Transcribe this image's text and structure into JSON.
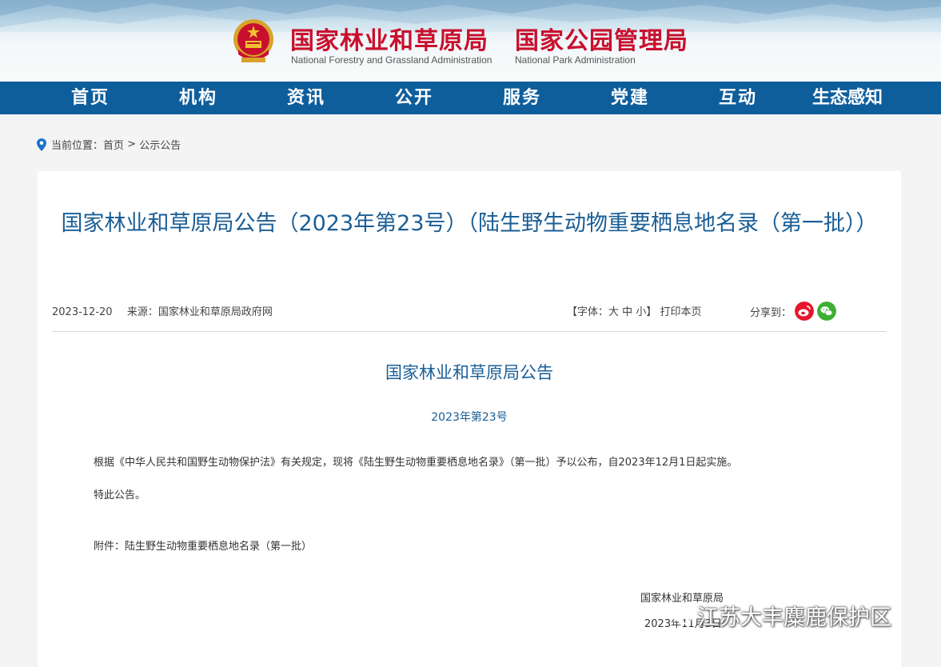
{
  "header": {
    "org1_cn": "国家林业和草原局",
    "org1_en": "National Forestry and Grassland Administration",
    "org2_cn": "国家公园管理局",
    "org2_en": "National Park Administration"
  },
  "nav": {
    "items": [
      "首页",
      "机构",
      "资讯",
      "公开",
      "服务",
      "党建",
      "互动",
      "生态感知"
    ]
  },
  "breadcrumb": {
    "label": "当前位置：",
    "home": "首页",
    "sep": " > ",
    "current": "公示公告"
  },
  "article": {
    "title": "国家林业和草原局公告（2023年第23号）（陆生野生动物重要栖息地名录（第一批））",
    "date": "2023-12-20",
    "source_label": "来源：",
    "source": "国家林业和草原局政府网",
    "font_prefix": "【字体：",
    "font_large": "大",
    "font_medium": "中",
    "font_small": "小",
    "font_suffix": "】",
    "print": "打印本页",
    "share_label": "分享到：",
    "doc_heading": "国家林业和草原局公告",
    "doc_number": "2023年第23号",
    "paragraph1": "根据《中华人民共和国野生动物保护法》有关规定，现将《陆生野生动物重要栖息地名录》（第一批）予以公布，自2023年12月1日起实施。",
    "paragraph2": "特此公告。",
    "attachment": "附件：陆生野生动物重要栖息地名录（第一批）",
    "signature": "国家林业和草原局",
    "signature_date": "2023年11月3日"
  },
  "watermark": {
    "text": "江苏大丰麋鹿保护区"
  },
  "colors": {
    "nav_bg": "#0f5e9c",
    "title_blue": "#1a5e96",
    "org_red": "#c8102e",
    "weibo": "#e6162d",
    "wechat": "#3cb034"
  },
  "icons": [
    "location-pin-icon",
    "national-emblem-icon",
    "weibo-icon",
    "wechat-icon"
  ]
}
